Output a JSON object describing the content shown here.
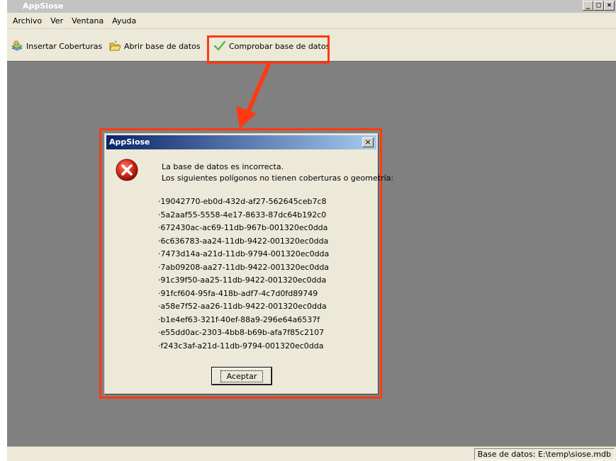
{
  "window": {
    "title": "AppSiose",
    "controls": [
      "_",
      "□",
      "×"
    ]
  },
  "menu": {
    "items": [
      "Archivo",
      "Ver",
      "Ventana",
      "Ayuda"
    ]
  },
  "toolbar": {
    "insert_label": "Insertar Coberturas",
    "open_label": "Abrir base de datos",
    "check_label": "Comprobar base de datos",
    "icons": {
      "insert": "insert-layers-icon",
      "open": "open-folder-icon",
      "check": "checkmark-icon"
    }
  },
  "dialog": {
    "title": "AppSiose",
    "close_label": "×",
    "message_line1": "La base de datos es incorrecta.",
    "message_line2": "Los siguientes polígonos no tienen coberturas o geometría:",
    "polygons": [
      "19042770-eb0d-432d-af27-562645ceb7c8",
      "5a2aaf55-5558-4e17-8633-87dc64b192c0",
      "672430ac-ac69-11db-967b-001320ec0dda",
      "6c636783-aa24-11db-9422-001320ec0dda",
      "7473d14a-a21d-11db-9794-001320ec0dda",
      "7ab09208-aa27-11db-9422-001320ec0dda",
      "91c39f50-aa25-11db-9422-001320ec0dda",
      "91fcf604-95fa-418b-adf7-4c7d0fd89749",
      "a58e7f52-aa26-11db-9422-001320ec0dda",
      "b1e4ef63-321f-40ef-88a9-296e64a6537f",
      "e55dd0ac-2303-4bb8-b69b-afa7f85c2107",
      "f243c3af-a21d-11db-9794-001320ec0dda"
    ],
    "ok_label": "Aceptar",
    "icon": "error-icon"
  },
  "status": {
    "text": "Base de datos: E:\\temp\\siose.mdb"
  },
  "colors": {
    "annotation": "#ff3a10",
    "workspace": "#808080",
    "chrome": "#ece9d8"
  }
}
